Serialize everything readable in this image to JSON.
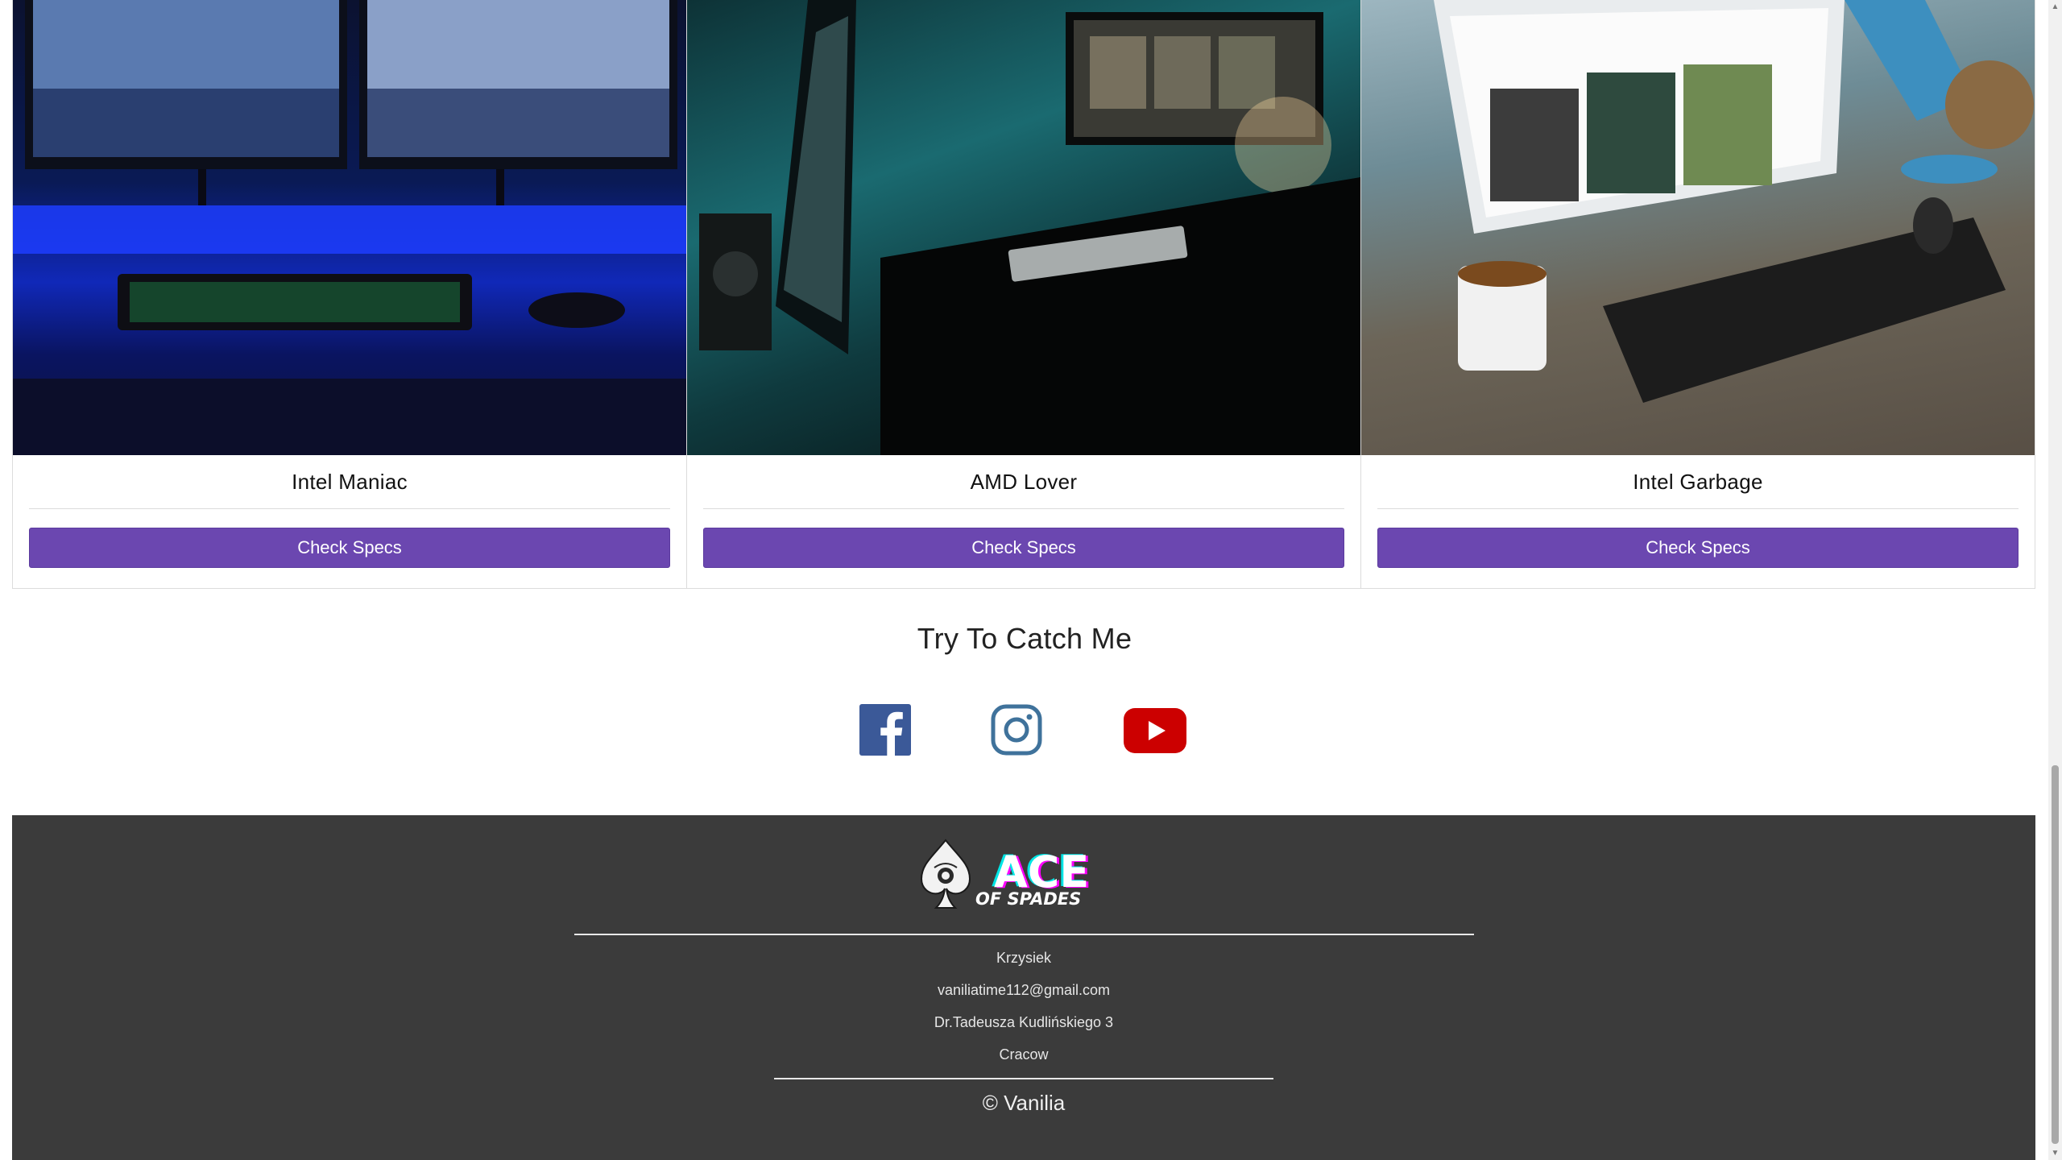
{
  "cards": [
    {
      "title": "Intel Maniac",
      "button": "Check Specs",
      "image": "dual-monitor-blue-desk-photo"
    },
    {
      "title": "AMD Lover",
      "button": "Check Specs",
      "image": "teal-gaming-setup-photo"
    },
    {
      "title": "Intel Garbage",
      "button": "Check Specs",
      "image": "desk-with-keyboard-mug-photo"
    }
  ],
  "social": {
    "title": "Try To Catch Me",
    "icons": [
      {
        "name": "facebook-icon",
        "color": "#3b5998"
      },
      {
        "name": "instagram-icon",
        "color": "#3f729b"
      },
      {
        "name": "youtube-icon",
        "color": "#cc0000"
      }
    ]
  },
  "footer": {
    "logo_text_main": "ACE",
    "logo_text_sub": "OF SPADES",
    "name": "Krzysiek",
    "email": "vaniliatime112@gmail.com",
    "address": "Dr.Tadeusza Kudlińskiego 3",
    "city": "Cracow",
    "copyright": "© Vanilia"
  },
  "colors": {
    "button": "#6b47b0",
    "footer_bg": "#3b3b3b"
  }
}
